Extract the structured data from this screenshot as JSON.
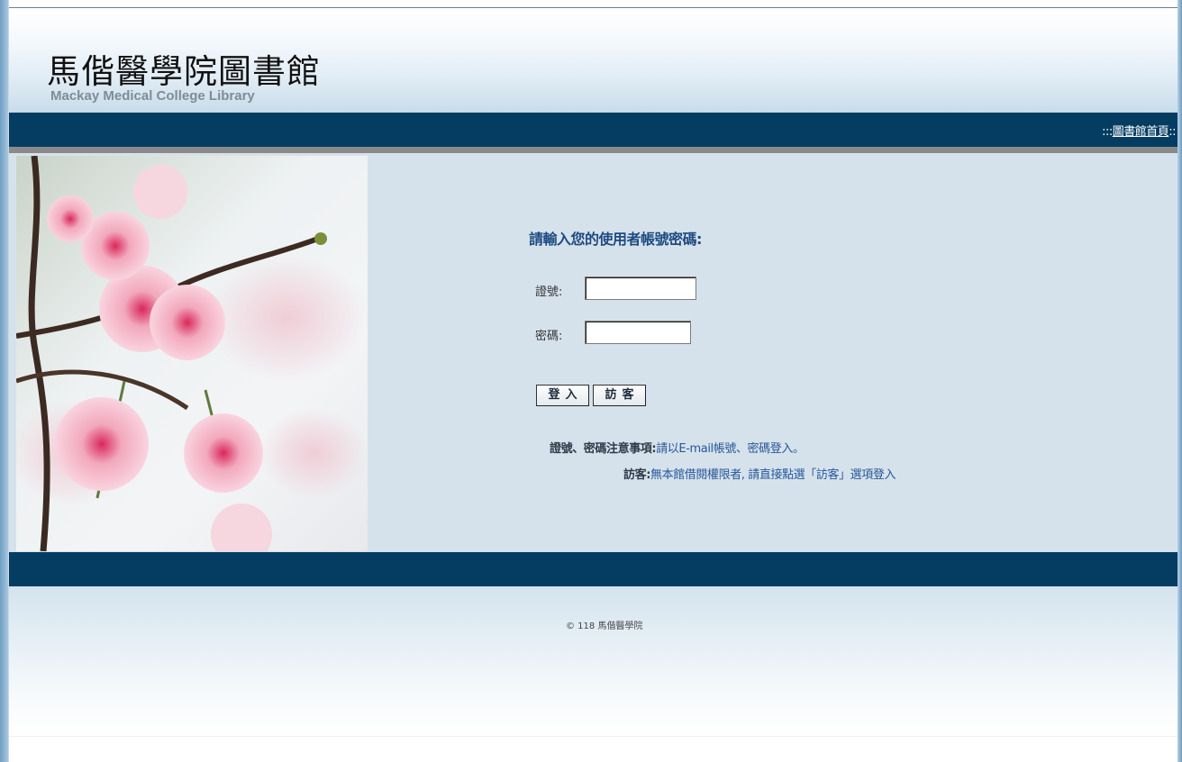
{
  "header": {
    "logo_cn": "馬偕醫學院圖書館",
    "logo_en": "Mackay Medical College Library"
  },
  "nav": {
    "prefix": ":::",
    "home_link": "圖書館首頁",
    "suffix": "::"
  },
  "login": {
    "prompt": "請輸入您的使用者帳號密碼:",
    "account_label": "證號:",
    "password_label": "密碼:",
    "account_value": "",
    "password_value": "",
    "login_button": "登入",
    "guest_button": "訪客"
  },
  "notes": {
    "note1_key": "證號、密碼注意事項:",
    "note1_value": "請以E-mail帳號、密碼登入。",
    "note2_key": "訪客:",
    "note2_value": "無本館借閱權限者, 請直接點選「訪客」選項登入"
  },
  "footer": {
    "copyright": "© 118 馬偕醫學院"
  },
  "colors": {
    "navbar": "#053c62",
    "accent_text": "#25579a",
    "panel_bg": "#d6e2eb"
  }
}
